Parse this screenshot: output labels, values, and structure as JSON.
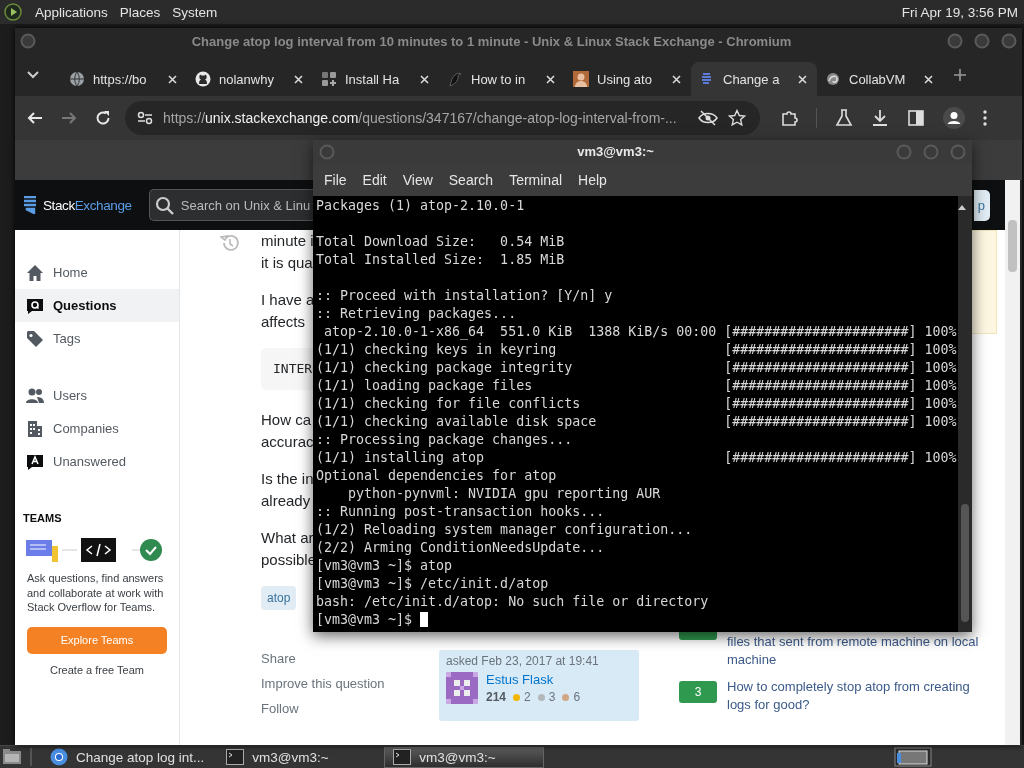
{
  "top_panel": {
    "menus": [
      "Applications",
      "Places",
      "System"
    ],
    "clock": "Fri Apr 19,  3:56 PM"
  },
  "browser": {
    "title": "Change atop log interval from 10 minutes to 1 minute - Unix & Linux Stack Exchange - Chromium",
    "tabs": [
      {
        "label": "https://bo",
        "selected": false
      },
      {
        "label": "nolanwhy",
        "selected": false
      },
      {
        "label": "Install Ha",
        "selected": false
      },
      {
        "label": "How to in",
        "selected": false
      },
      {
        "label": "Using ato",
        "selected": false
      },
      {
        "label": "Change a",
        "selected": true
      },
      {
        "label": "CollabVM",
        "selected": false
      }
    ],
    "url": {
      "scheme": "https://",
      "host": "unix.stackexchange.com",
      "path": "/questions/347167/change-atop-log-interval-from-..."
    },
    "forward_disabled": true,
    "site": {
      "logo": {
        "first": "Stack",
        "second": "Exchange"
      },
      "search_placeholder": "Search on Unix & Linu",
      "header_button": "p",
      "nav_groups": [
        {
          "items": [
            {
              "label": "Home",
              "selected": false
            },
            {
              "label": "Questions",
              "selected": true
            },
            {
              "label": "Tags",
              "selected": false
            }
          ]
        },
        {
          "items": [
            {
              "label": "Users",
              "selected": false
            },
            {
              "label": "Companies",
              "selected": false
            },
            {
              "label": "Unanswered",
              "selected": false
            }
          ]
        }
      ],
      "teams": {
        "heading": "TEAMS",
        "text": "Ask questions, find answers and collaborate at work with Stack Overflow for Teams.",
        "button": "Explore Teams",
        "link": "Create a free Team"
      },
      "body": [
        {
          "kind": "text",
          "lines": [
            "minute i",
            "it is qua"
          ]
        },
        {
          "kind": "text",
          "lines": [
            "I have a",
            "affects"
          ]
        },
        {
          "kind": "code",
          "text": "INTER"
        },
        {
          "kind": "text",
          "lines": [
            "How ca",
            "accurac"
          ]
        },
        {
          "kind": "text",
          "lines": [
            "Is the in",
            "already"
          ]
        },
        {
          "kind": "text",
          "lines": [
            "What ar",
            "possible"
          ]
        }
      ],
      "tags": [
        "atop"
      ],
      "actions": [
        "Share",
        "Improve this question",
        "Follow"
      ],
      "asked": {
        "label": "asked Feb 23, 2017 at 19:41",
        "user": "Estus Flask",
        "reputation": "214",
        "badges": [
          {
            "count": "2",
            "color": "#f1b600"
          },
          {
            "count": "3",
            "color": "#b4b8bc"
          },
          {
            "count": "6",
            "color": "#d1a684"
          }
        ]
      },
      "related": [
        {
          "title": "files that sent from remote machine on local machine"
        },
        {
          "count": "3",
          "title": "How to completely stop atop from creating logs for good?"
        }
      ]
    }
  },
  "terminal": {
    "title": "vm3@vm3:~",
    "menus": [
      "File",
      "Edit",
      "View",
      "Search",
      "Terminal",
      "Help"
    ],
    "lines": [
      {
        "kind": "line",
        "text": "Packages (1) atop-2.10.0-1"
      },
      {
        "kind": "blank"
      },
      {
        "kind": "line",
        "text": "Total Download Size:   0.54 MiB"
      },
      {
        "kind": "line",
        "text": "Total Installed Size:  1.85 MiB"
      },
      {
        "kind": "blank"
      },
      {
        "kind": "line",
        "text": ":: Proceed with installation? [Y/n] y"
      },
      {
        "kind": "line",
        "text": ":: Retrieving packages..."
      },
      {
        "kind": "line",
        "text": " atop-2.10.0-1-x86_64  551.0 KiB  1388 KiB/s 00:00",
        "progress": "[######################] 100%"
      },
      {
        "kind": "line",
        "text": "(1/1) checking keys in keyring",
        "progress": "[######################] 100%"
      },
      {
        "kind": "line",
        "text": "(1/1) checking package integrity",
        "progress": "[######################] 100%"
      },
      {
        "kind": "line",
        "text": "(1/1) loading package files",
        "progress": "[######################] 100%"
      },
      {
        "kind": "line",
        "text": "(1/1) checking for file conflicts",
        "progress": "[######################] 100%"
      },
      {
        "kind": "line",
        "text": "(1/1) checking available disk space",
        "progress": "[######################] 100%"
      },
      {
        "kind": "line",
        "text": ":: Processing package changes..."
      },
      {
        "kind": "line",
        "text": "(1/1) installing atop",
        "progress": "[######################] 100%"
      },
      {
        "kind": "line",
        "text": "Optional dependencies for atop"
      },
      {
        "kind": "line",
        "text": "    python-pynvml: NVIDIA gpu reporting AUR"
      },
      {
        "kind": "line",
        "text": ":: Running post-transaction hooks..."
      },
      {
        "kind": "line",
        "text": "(1/2) Reloading system manager configuration..."
      },
      {
        "kind": "line",
        "text": "(2/2) Arming ConditionNeedsUpdate..."
      },
      {
        "kind": "line",
        "text": "[vm3@vm3 ~]$ atop"
      },
      {
        "kind": "line",
        "text": "[vm3@vm3 ~]$ /etc/init.d/atop"
      },
      {
        "kind": "line",
        "text": "bash: /etc/init.d/atop: No such file or directory"
      },
      {
        "kind": "line",
        "text": "[vm3@vm3 ~]$",
        "cursor": true
      }
    ]
  },
  "taskbar": {
    "items": [
      {
        "label": "Change atop log int...",
        "selected": false
      },
      {
        "label": "vm3@vm3:~",
        "selected": false
      },
      {
        "label": "vm3@vm3:~",
        "selected": true
      }
    ]
  }
}
